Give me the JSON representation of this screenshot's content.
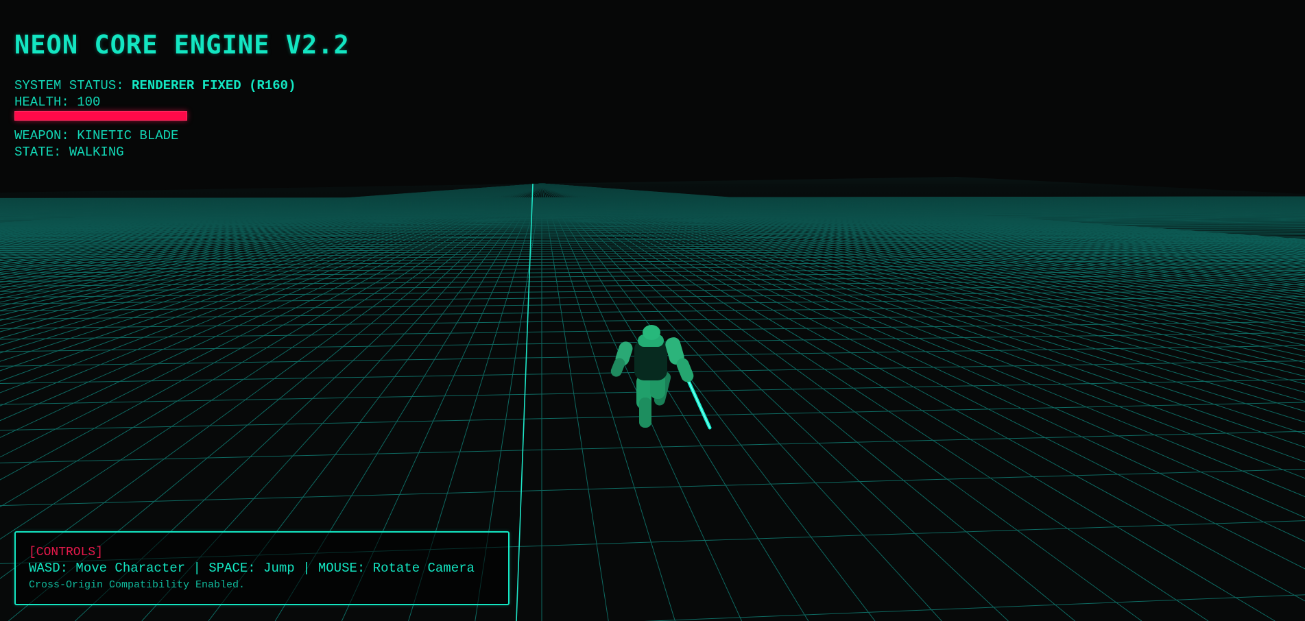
{
  "game": {
    "title": "NEON CORE ENGINE V2.2",
    "theme_color": "#13e6c2",
    "alert_color": "#ff0a49"
  },
  "status": {
    "label": "SYSTEM STATUS:",
    "value": "RENDERER FIXED (R160)"
  },
  "health": {
    "label": "HEALTH:",
    "value": "100",
    "level": 1.0
  },
  "weapon": {
    "text": "WEAPON: KINETIC BLADE"
  },
  "state": {
    "text": "STATE: WALKING"
  },
  "controls": {
    "header": "[CONTROLS]",
    "keys": "WASD: Move Character | SPACE: Jump | MOUSE: Rotate Camera",
    "note": "Cross-Origin Compatibility Enabled."
  },
  "scene": {
    "floor": "neon-grid-floor",
    "character": "green-humanoid-robot",
    "weapon_glow": "cyan-blade"
  }
}
